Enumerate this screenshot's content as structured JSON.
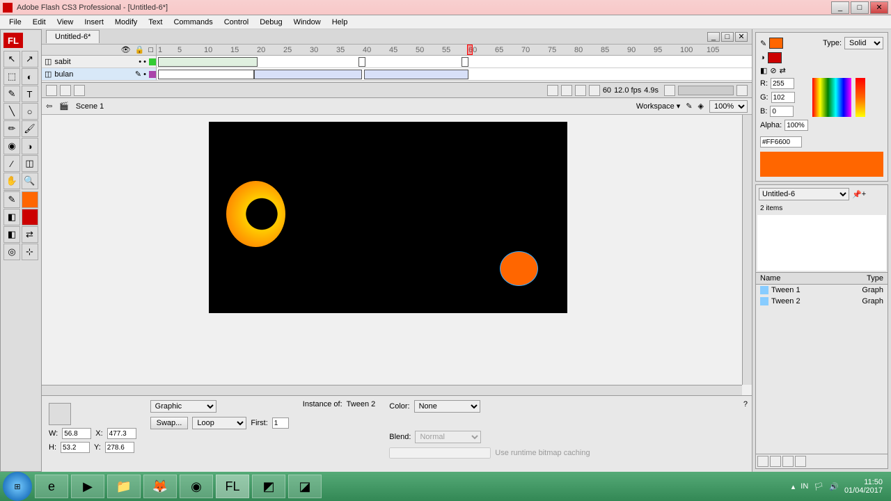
{
  "titlebar": {
    "icon": "FL",
    "text": "Adobe Flash CS3 Professional - [Untitled-6*]"
  },
  "menu": [
    "File",
    "Edit",
    "View",
    "Insert",
    "Modify",
    "Text",
    "Commands",
    "Control",
    "Debug",
    "Window",
    "Help"
  ],
  "doc_tab": "Untitled-6*",
  "timeline": {
    "ruler": [
      "1",
      "5",
      "10",
      "15",
      "20",
      "25",
      "30",
      "35",
      "40",
      "45",
      "50",
      "55",
      "60",
      "65",
      "70",
      "75",
      "80",
      "85",
      "90",
      "95",
      "100",
      "105"
    ],
    "layers": [
      {
        "name": "sabit",
        "color": "#3c3"
      },
      {
        "name": "bulan",
        "color": "#a4a"
      }
    ],
    "controls": {
      "frame": "60",
      "fps": "12.0 fps",
      "time": "4.9s"
    }
  },
  "scene": {
    "label": "Scene 1",
    "workspace": "Workspace ▾",
    "zoom": "100%"
  },
  "color_panel": {
    "type_label": "Type:",
    "type_value": "Solid",
    "r_label": "R:",
    "r": "255",
    "g_label": "G:",
    "g": "102",
    "b_label": "B:",
    "b": "0",
    "alpha_label": "Alpha:",
    "alpha": "100%",
    "hex": "#FF6600"
  },
  "library": {
    "doc": "Untitled-6",
    "count": "2 items",
    "headers": {
      "name": "Name",
      "type": "Type"
    },
    "items": [
      {
        "name": "Tween 1",
        "type": "Graph"
      },
      {
        "name": "Tween 2",
        "type": "Graph"
      }
    ]
  },
  "properties": {
    "type": "Graphic",
    "instance_label": "Instance of:",
    "instance": "Tween 2",
    "swap": "Swap...",
    "loop": "Loop",
    "first_label": "First:",
    "first": "1",
    "color_label": "Color:",
    "color": "None",
    "blend_label": "Blend:",
    "blend": "Normal",
    "runtime": "Use runtime bitmap caching",
    "w_label": "W:",
    "w": "56.8",
    "x_label": "X:",
    "x": "477.3",
    "h_label": "H:",
    "h": "53.2",
    "y_label": "Y:",
    "y": "278.6"
  },
  "taskbar": {
    "lang": "IN",
    "time": "11:50",
    "date": "01/04/2017"
  }
}
